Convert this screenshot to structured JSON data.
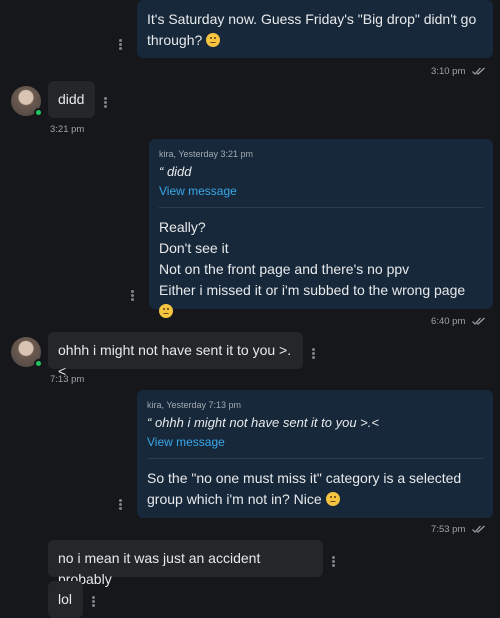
{
  "messages": [
    {
      "text_l1": "It's Saturday now. Guess Friday's \"Big drop\" didn't go",
      "text_l2": "through?",
      "emoji": "persevering-face",
      "time": "3:10 pm"
    },
    {
      "text": "didd",
      "time": "3:21 pm"
    },
    {
      "quote_header": "kira, Yesterday 3:21 pm",
      "quote_text": "“ didd",
      "view_label": "View message",
      "lines": [
        "Really?",
        "Don't see it",
        "Not on the front page and there's no ppv",
        "Either i missed it or i'm subbed to the wrong page"
      ],
      "emoji": "thinking-face",
      "time": "6:40 pm"
    },
    {
      "text": "ohhh i might not have sent it to you >.<",
      "time": "7:13 pm"
    },
    {
      "quote_header": "kira, Yesterday 7:13 pm",
      "quote_text": "“ ohhh i might not have sent it to you >.<",
      "view_label": "View message",
      "lines": [
        "So the \"no one must miss it\" category is a selected",
        "group which i'm not in? Nice"
      ],
      "emoji": "disappointed-face",
      "time": "7:53 pm"
    },
    {
      "text": "no i mean it was just an accident probably"
    },
    {
      "text": "lol"
    }
  ],
  "colors": {
    "outgoing_bubble": "#16283a",
    "incoming_bubble": "#24262a",
    "link": "#3aa7e8",
    "online": "#21c55d",
    "background": "#16171a"
  }
}
